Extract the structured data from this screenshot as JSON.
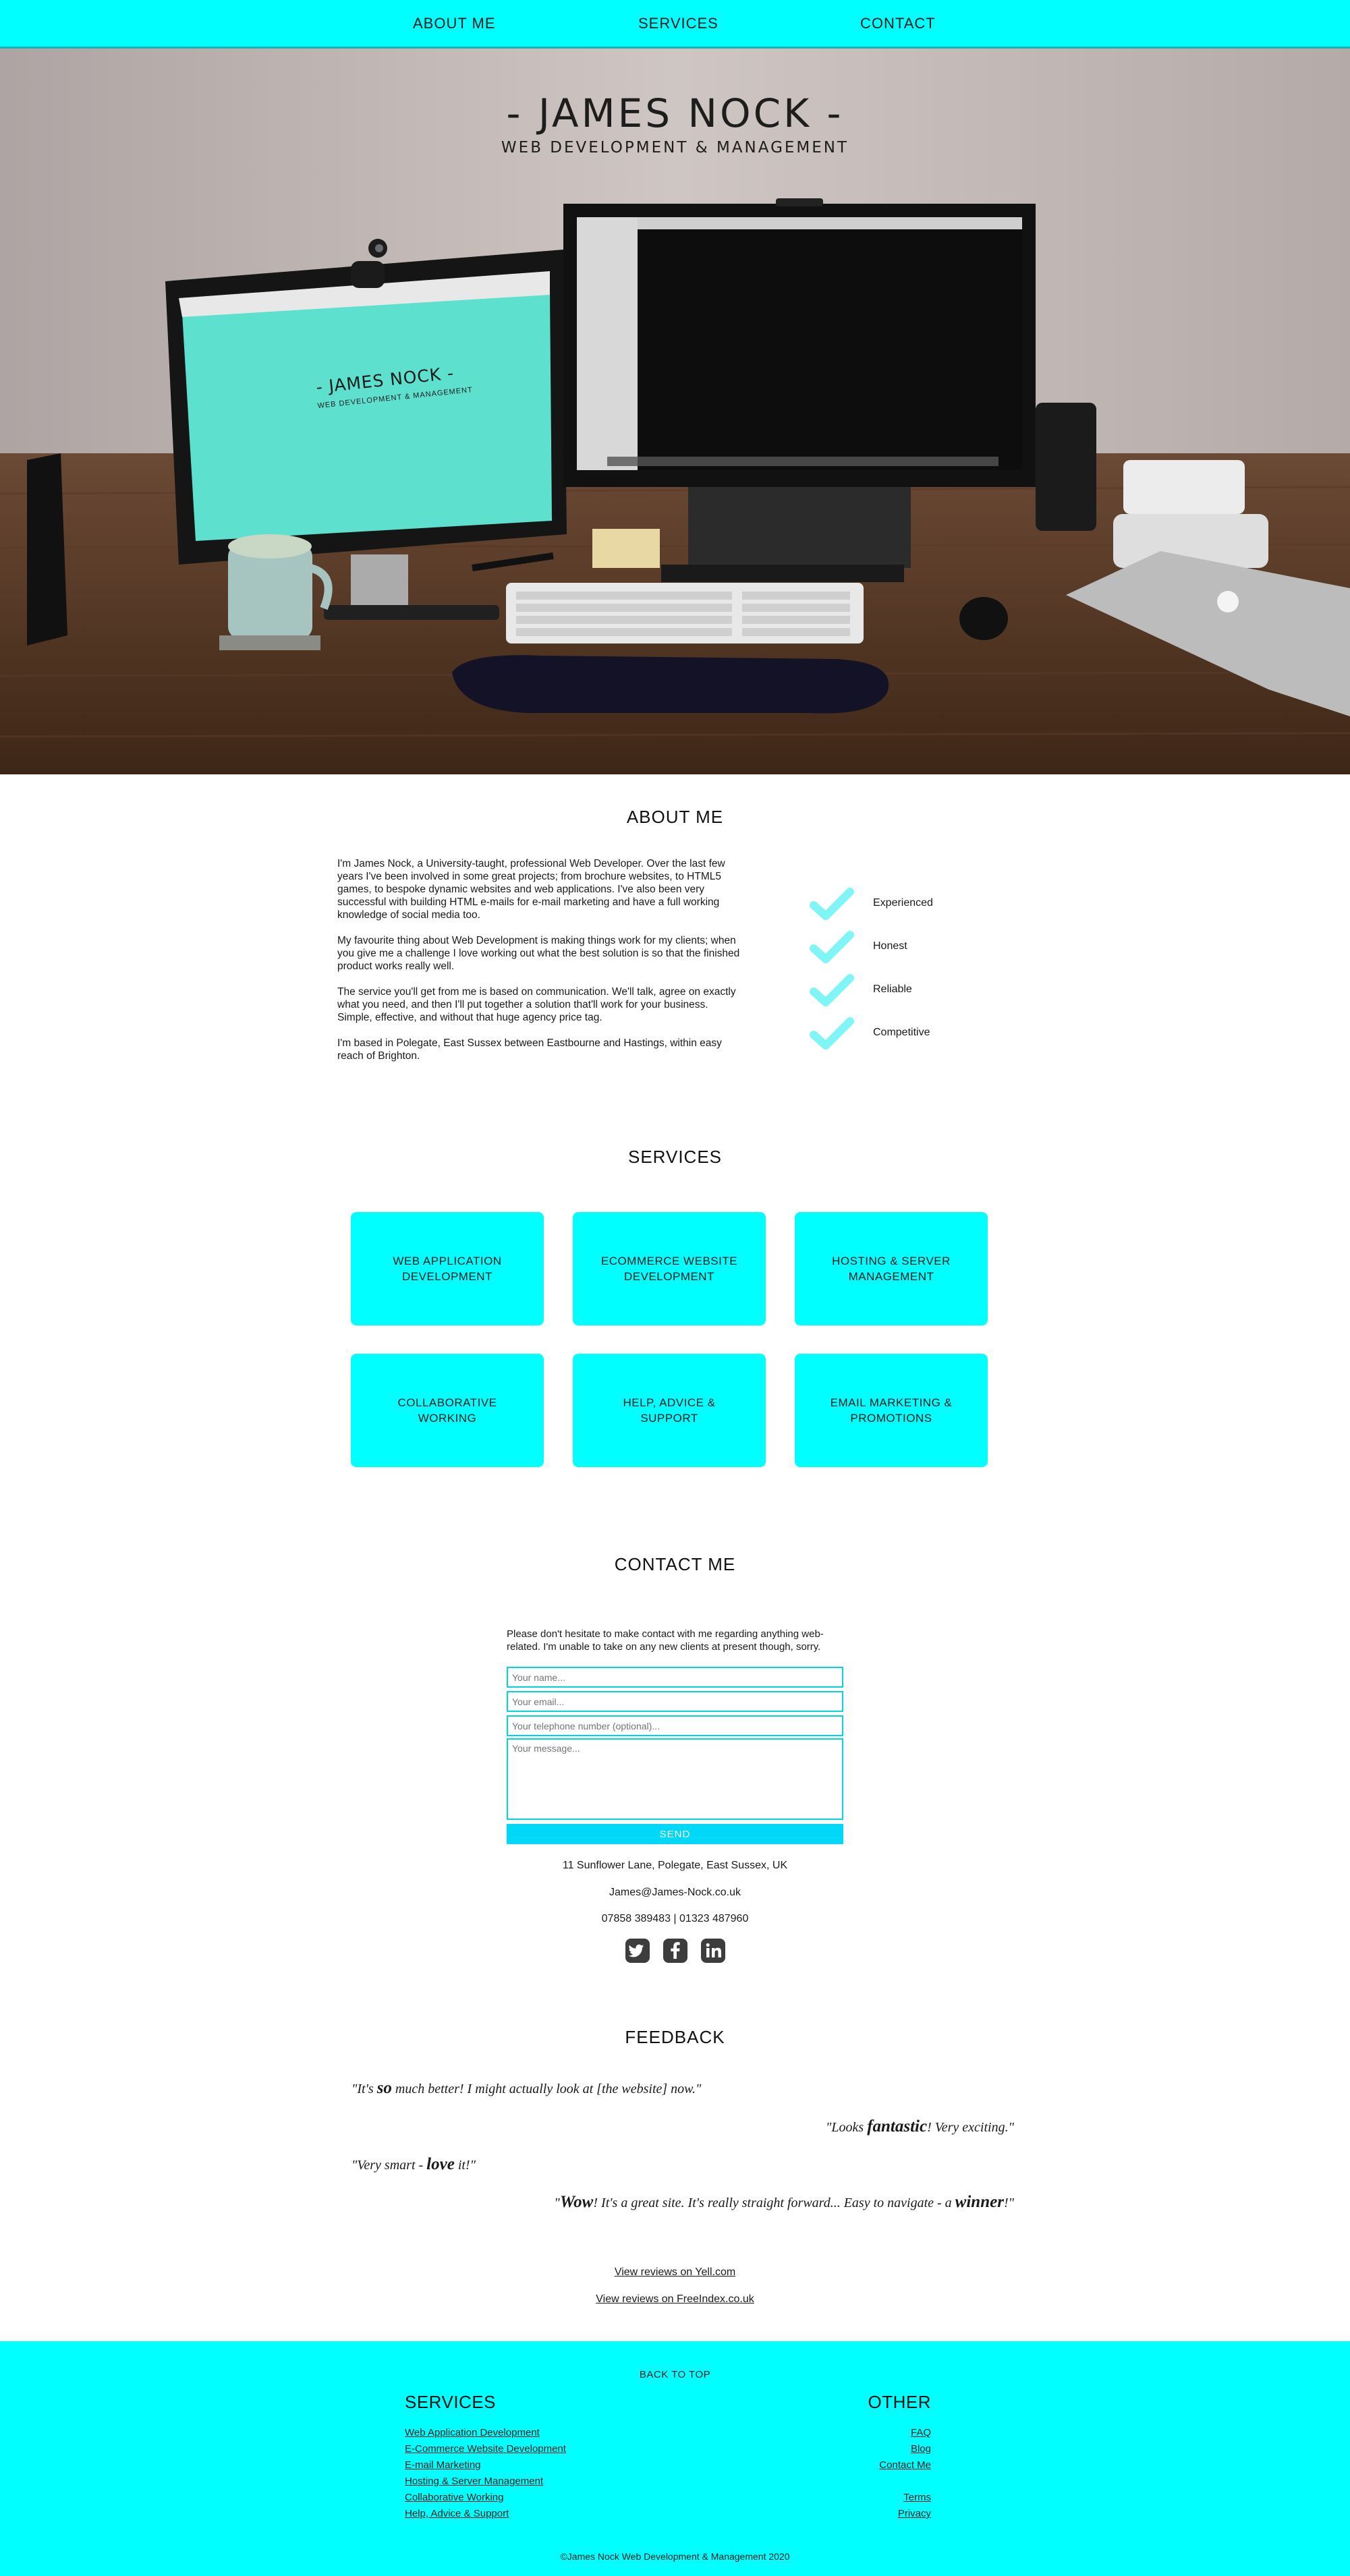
{
  "nav": {
    "about": "ABOUT ME",
    "services": "SERVICES",
    "contact": "CONTACT"
  },
  "hero": {
    "title": "- JAMES NOCK -",
    "subtitle": "WEB DEVELOPMENT & MANAGEMENT",
    "screen_title": "- JAMES NOCK -",
    "screen_subtitle": "WEB DEVELOPMENT & MANAGEMENT"
  },
  "about": {
    "heading": "ABOUT ME",
    "paragraphs": [
      "I'm James Nock, a University-taught, professional Web Developer. Over the last few years I've been involved in some great projects; from brochure websites, to HTML5 games, to bespoke dynamic websites and web applications. I've also been very successful with building HTML e-mails for e-mail marketing and have a full working knowledge of social media too.",
      "My favourite thing about Web Development is making things work for my clients; when you give me a challenge I love working out what the best solution is so that the finished product works really well.",
      "The service you'll get from me is based on communication. We'll talk, agree on exactly what you need, and then I'll put together a solution that'll work for your business. Simple, effective, and without that huge agency price tag.",
      "I'm based in Polegate, East Sussex between Eastbourne and Hastings, within easy reach of Brighton."
    ],
    "qualities": [
      "Experienced",
      "Honest",
      "Reliable",
      "Competitive"
    ]
  },
  "services": {
    "heading": "SERVICES",
    "items": [
      "WEB APPLICATION DEVELOPMENT",
      "ECOMMERCE WEBSITE DEVELOPMENT",
      "HOSTING & SERVER MANAGEMENT",
      "COLLABORATIVE WORKING",
      "HELP, ADVICE & SUPPORT",
      "EMAIL MARKETING & PROMOTIONS"
    ]
  },
  "contact": {
    "heading": "CONTACT ME",
    "intro": "Please don't hesitate to make contact with me regarding anything web-related. I'm unable to take on any new clients at present though, sorry.",
    "name_placeholder": "Your name...",
    "email_placeholder": "Your email...",
    "phone_placeholder": "Your telephone number (optional)...",
    "message_placeholder": "Your message...",
    "send_label": "SEND",
    "address": "11 Sunflower Lane, Polegate, East Sussex, UK",
    "email": "James@James-Nock.co.uk",
    "phone": "07858 389483 | 01323 487960",
    "social": [
      "twitter-icon",
      "facebook-icon",
      "linkedin-icon"
    ]
  },
  "feedback": {
    "heading": "FEEDBACK",
    "quotes": [
      {
        "pre": "\"It's ",
        "em": "so",
        "post": " much better! I might actually look at [the website] now.\""
      },
      {
        "pre": "\"Looks ",
        "em": "fantastic",
        "post": "! Very exciting.\""
      },
      {
        "pre": "\"Very smart - ",
        "em": "love",
        "post": " it!\""
      },
      {
        "pre": "\"",
        "em": "Wow",
        "post": "! It's a great site. It's really straight forward... Easy to navigate - a ",
        "em2": "winner",
        "post2": "!\""
      }
    ],
    "link_yell": "View reviews on Yell.com",
    "link_freeindex": "View reviews on FreeIndex.co.uk"
  },
  "footer": {
    "back_to_top": "BACK TO TOP",
    "services_heading": "SERVICES",
    "services_links": [
      "Web Application Development",
      "E-Commerce Website Development",
      "E-mail Marketing",
      "Hosting & Server Management",
      "Collaborative Working",
      "Help, Advice & Support"
    ],
    "other_heading": "OTHER",
    "other_links": [
      "FAQ",
      "Blog",
      "Contact Me",
      "Terms",
      "Privacy"
    ],
    "copyright": "©James Nock Web Development & Management 2020"
  },
  "colors": {
    "accent": "#00ffff",
    "send_button": "#00d8f8",
    "check": "#7ff5f5",
    "social": "#3d3d3d"
  }
}
